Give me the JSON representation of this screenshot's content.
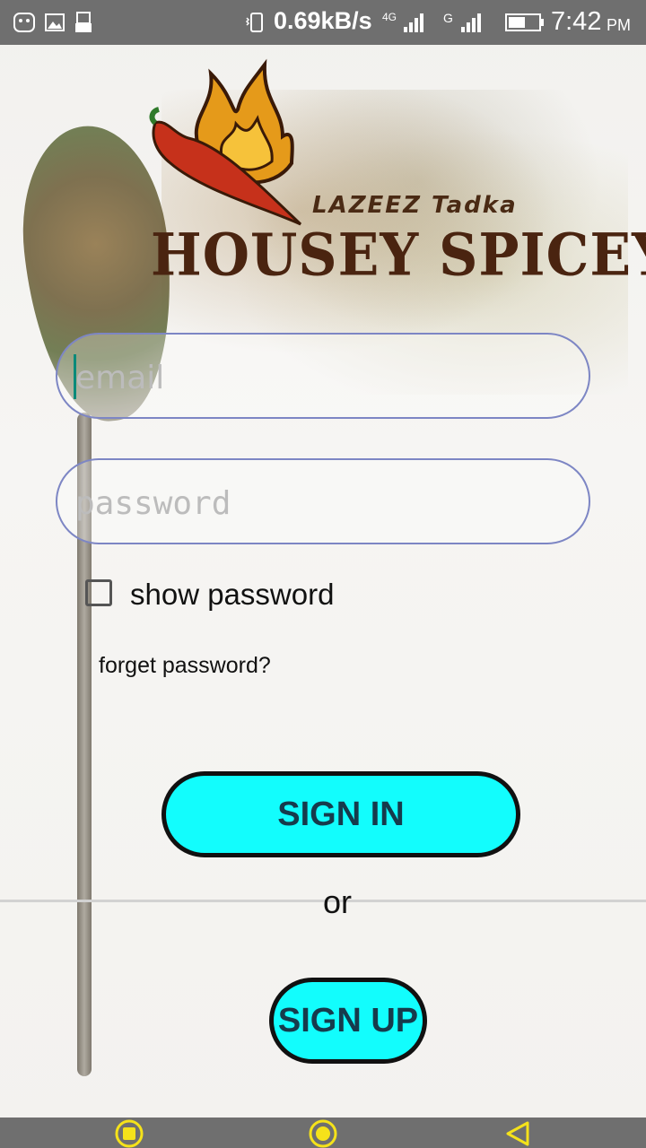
{
  "status_bar": {
    "speed": "0.69kB/s",
    "network_1": "4G",
    "network_2": "G",
    "time": "7:42",
    "ampm": "PM"
  },
  "logo": {
    "tagline": "LAZEEZ Tadka",
    "title": "HOUSEY SPICEY"
  },
  "form": {
    "email_placeholder": "email",
    "password_placeholder": "password",
    "show_password_label": "show password",
    "forgot_label": "forget password?"
  },
  "buttons": {
    "sign_in": "SIGN IN",
    "or": "or",
    "sign_up": "SIGN UP"
  },
  "nav": {
    "items": [
      "recents-button-icon",
      "home-button-icon",
      "back-button-icon"
    ]
  },
  "colors": {
    "accent": "#12fdfd",
    "input_border": "#7d86c4",
    "logo_brown": "#4a2410",
    "bars": "#6f6f6f",
    "nav_icons": "#f5e21a"
  }
}
